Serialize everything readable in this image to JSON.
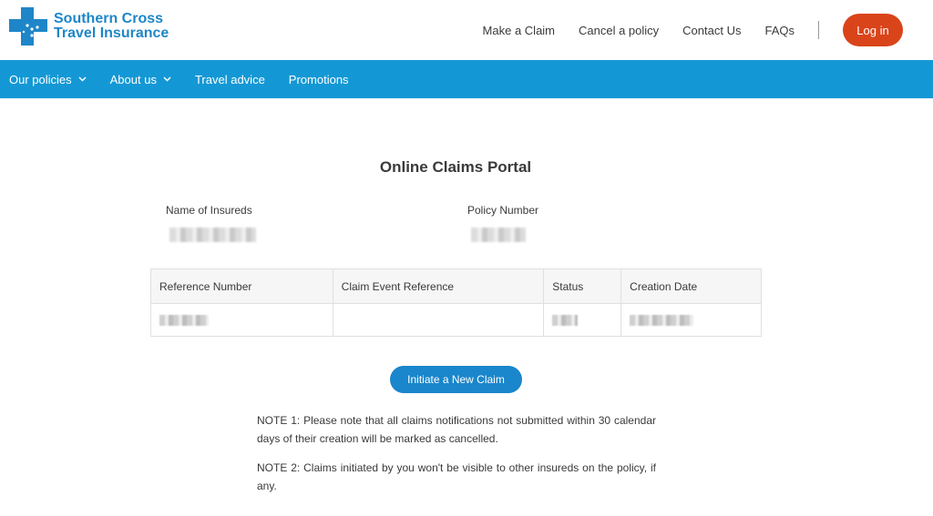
{
  "brand": {
    "line1": "Southern Cross",
    "line2": "Travel Insurance",
    "color": "#1e86c8",
    "icon": "cross-logo-icon"
  },
  "top_nav": {
    "items": [
      "Make a Claim",
      "Cancel a policy",
      "Contact Us",
      "FAQs"
    ],
    "login_label": "Log in",
    "login_color": "#d9441a"
  },
  "main_nav": {
    "color": "#1498d5",
    "items": [
      {
        "label": "Our policies",
        "has_dropdown": true
      },
      {
        "label": "About us",
        "has_dropdown": true
      },
      {
        "label": "Travel advice",
        "has_dropdown": false
      },
      {
        "label": "Promotions",
        "has_dropdown": false
      }
    ]
  },
  "portal": {
    "title": "Online Claims Portal",
    "insured_label": "Name of Insureds",
    "policy_label": "Policy Number"
  },
  "table": {
    "headers": [
      "Reference Number",
      "Claim Event Reference",
      "Status",
      "Creation Date"
    ]
  },
  "actions": {
    "new_claim_label": "Initiate a New Claim",
    "button_color": "#1a86cb"
  },
  "notes": [
    "NOTE 1: Please note that all claims notifications not submitted within 30 calendar days of their creation will be marked as cancelled.",
    "NOTE 2: Claims initiated by you won't be visible to other insureds on the policy, if any."
  ]
}
